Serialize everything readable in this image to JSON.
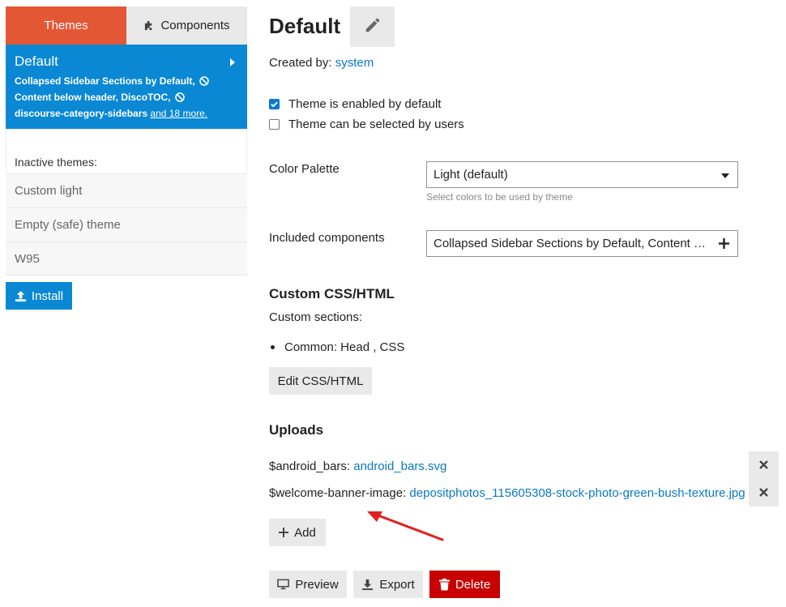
{
  "sidebar": {
    "tabs": [
      {
        "label": "Themes",
        "active": true
      },
      {
        "label": "Components",
        "icon": "puzzle-icon",
        "active": false
      }
    ],
    "selected_theme": {
      "name": "Default",
      "components_line1": "Collapsed Sidebar Sections by Default,",
      "components_line2": "Content below header, DiscoTOC,",
      "components_line3": "discourse-category-sidebars",
      "more_link": "and 18 more."
    },
    "inactive_label": "Inactive themes:",
    "inactive_themes": [
      "Custom light",
      "Empty (safe) theme",
      "W95"
    ],
    "install_label": "Install"
  },
  "main": {
    "title": "Default",
    "created_by_label": "Created by:",
    "created_by_value": "system",
    "checkboxes": [
      {
        "label": "Theme is enabled by default",
        "checked": true
      },
      {
        "label": "Theme can be selected by users",
        "checked": false
      }
    ],
    "color_palette": {
      "label": "Color Palette",
      "value": "Light (default)",
      "hint": "Select colors to be used by theme"
    },
    "included_components": {
      "label": "Included components",
      "value": "Collapsed Sidebar Sections by Default, Content below header, DiscoTOC"
    },
    "custom_css": {
      "heading": "Custom CSS/HTML",
      "sections_label": "Custom sections:",
      "section_item": "Common: Head , CSS",
      "edit_button": "Edit CSS/HTML"
    },
    "uploads": {
      "heading": "Uploads",
      "items": [
        {
          "var": "$android_bars:",
          "file": "android_bars.svg"
        },
        {
          "var": "$welcome-banner-image:",
          "file": "depositphotos_115605308-stock-photo-green-bush-texture.jpg"
        }
      ],
      "add_button": "Add"
    },
    "actions": {
      "preview": "Preview",
      "export": "Export",
      "delete": "Delete"
    }
  },
  "colors": {
    "active_tab": "#e45735",
    "selected_theme": "#0a88d4",
    "link": "#0a78c2",
    "danger": "#c80001",
    "annotation_arrow": "#e02020"
  }
}
